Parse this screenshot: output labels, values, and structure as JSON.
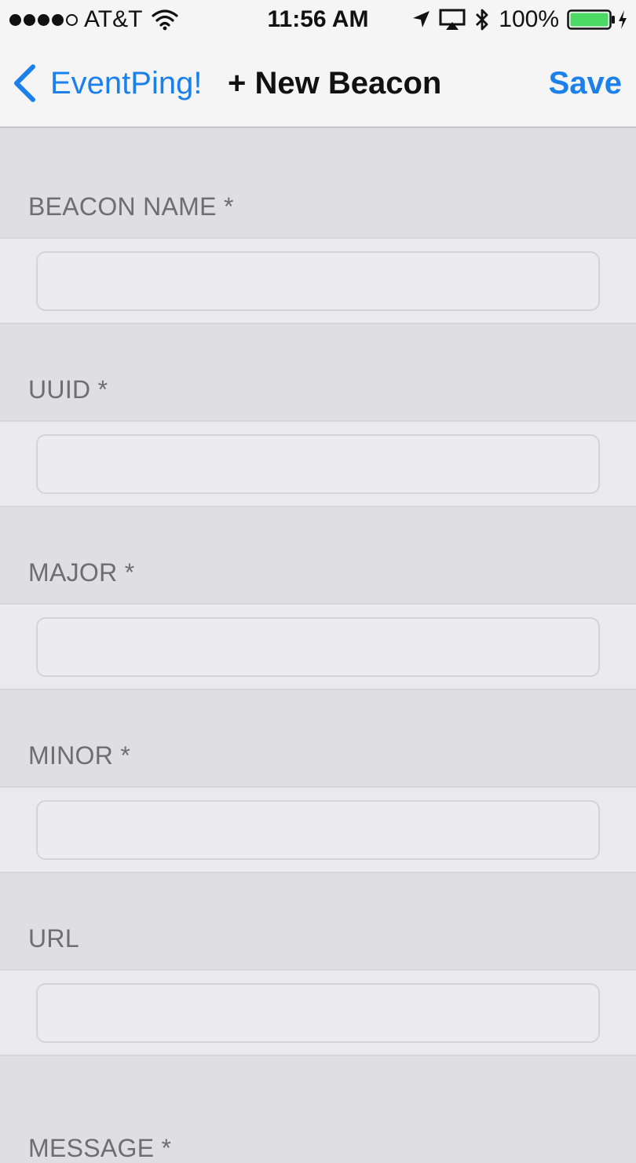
{
  "status_bar": {
    "carrier": "AT&T",
    "signal_bars_filled": 4,
    "signal_bars_total": 5,
    "time": "11:56 AM",
    "battery": "100%",
    "icons": [
      "wifi-icon",
      "location-arrow-icon",
      "airplay-icon",
      "bluetooth-icon",
      "battery-icon",
      "charging-bolt-icon"
    ]
  },
  "nav": {
    "back_label": "EventPing!",
    "title": "+ New Beacon",
    "save_label": "Save"
  },
  "form": {
    "fields": [
      {
        "label": "BEACON NAME *",
        "value": ""
      },
      {
        "label": "UUID *",
        "value": ""
      },
      {
        "label": "MAJOR *",
        "value": ""
      },
      {
        "label": "MINOR *",
        "value": ""
      },
      {
        "label": "URL",
        "value": ""
      },
      {
        "label": "MESSAGE *",
        "value": ""
      }
    ]
  },
  "colors": {
    "accent": "#1c80ea",
    "background": "#dfdee3",
    "bar_background": "#f5f5f6",
    "field_row_background": "#ebebed",
    "label_text": "#6d6d72",
    "battery_green": "#4cd964"
  }
}
